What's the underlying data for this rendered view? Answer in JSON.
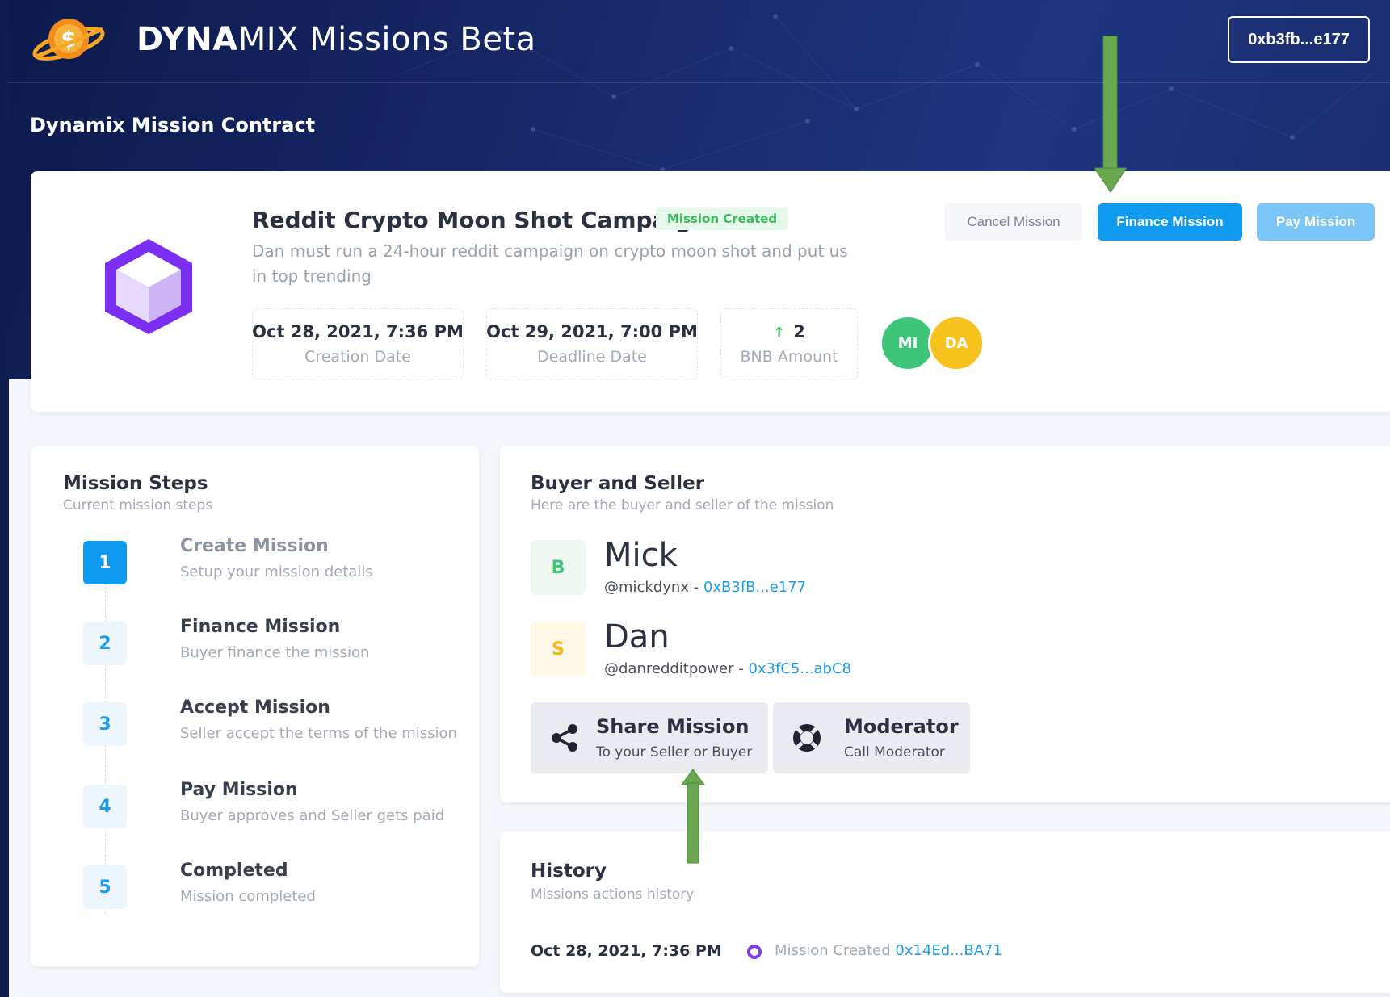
{
  "brand": {
    "bold": "DYNA",
    "regular": "MIX Missions Beta"
  },
  "wallet": {
    "label": "0xb3fb...e177"
  },
  "page": {
    "heading": "Dynamix Mission Contract"
  },
  "mission": {
    "title": "Reddit Crypto Moon Shot Campaign",
    "status": "Mission Created",
    "description": "Dan must run a 24-hour reddit campaign on crypto moon shot and put us in top trending",
    "stats": [
      {
        "value": "Oct 28, 2021, 7:36 PM",
        "label": "Creation Date"
      },
      {
        "value": "Oct 29, 2021, 7:00 PM",
        "label": "Deadline Date"
      },
      {
        "value": "2",
        "label": "BNB Amount"
      }
    ],
    "participants": [
      {
        "initials": "MI",
        "color": "#3ec57a"
      },
      {
        "initials": "DA",
        "color": "#f6c21b"
      }
    ],
    "actions": {
      "cancel": "Cancel Mission",
      "finance": "Finance Mission",
      "pay": "Pay Mission"
    }
  },
  "steps": {
    "title": "Mission Steps",
    "subtitle": "Current mission steps",
    "items": [
      {
        "num": "1",
        "title": "Create Mission",
        "sub": "Setup your mission details"
      },
      {
        "num": "2",
        "title": "Finance Mission",
        "sub": "Buyer finance the mission"
      },
      {
        "num": "3",
        "title": "Accept Mission",
        "sub": "Seller accept the terms of the mission"
      },
      {
        "num": "4",
        "title": "Pay Mission",
        "sub": "Buyer approves and Seller gets paid"
      },
      {
        "num": "5",
        "title": "Completed",
        "sub": "Mission completed"
      }
    ]
  },
  "buyer_seller": {
    "title": "Buyer and Seller",
    "subtitle": "Here are the buyer and seller of the mission",
    "buyer": {
      "badge": "B",
      "name": "Mick",
      "handle": "@mickdynx - ",
      "address": "0xB3fB...e177"
    },
    "seller": {
      "badge": "S",
      "name": "Dan",
      "handle": "@danredditpower - ",
      "address": "0x3fC5...abC8"
    },
    "share": {
      "title": "Share Mission",
      "sub": "To your Seller or Buyer"
    },
    "moderator": {
      "title": "Moderator",
      "sub": "Call Moderator"
    }
  },
  "history": {
    "title": "History",
    "subtitle": "Missions actions history",
    "entries": [
      {
        "date": "Oct 28, 2021, 7:36 PM",
        "text": "Mission Created ",
        "address": "0x14Ed...BA71"
      }
    ]
  },
  "colors": {
    "header_bg": "#14245e",
    "primary": "#0f9af0",
    "primary_light": "#7cc6f7",
    "success": "#3cb95c",
    "annotation_arrow": "#6aa84f"
  }
}
